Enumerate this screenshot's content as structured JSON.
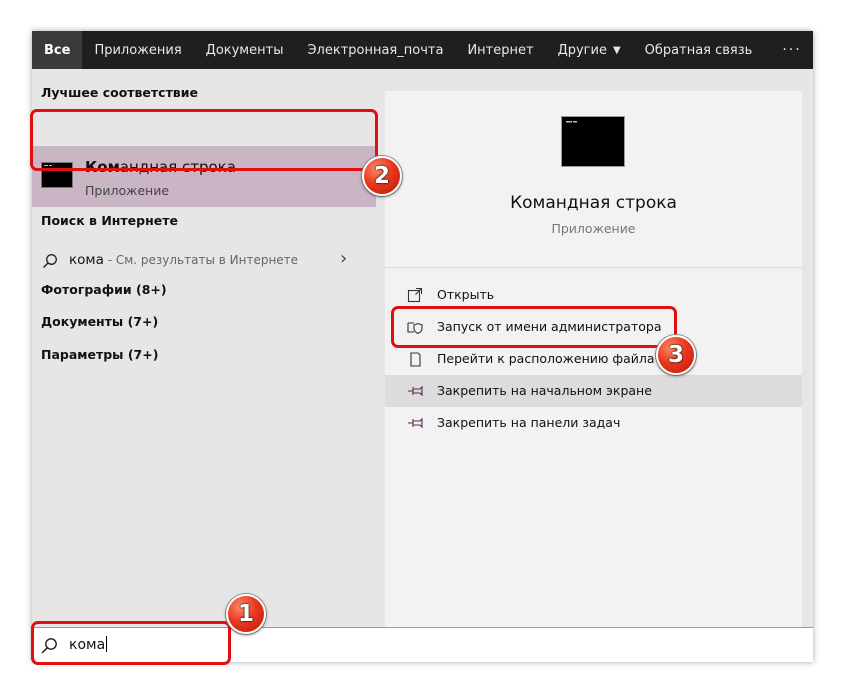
{
  "topnav": {
    "tabs": [
      {
        "label": "Все",
        "active": true
      },
      {
        "label": "Приложения"
      },
      {
        "label": "Документы"
      },
      {
        "label": "Электронная_почта"
      },
      {
        "label": "Интернет"
      },
      {
        "label": "Другие"
      }
    ],
    "feedback": "Обратная связь",
    "more": "···"
  },
  "left": {
    "best_match_header": "Лучшее соответствие",
    "best_match": {
      "title_bold": "Ком",
      "title_rest": "андная строка",
      "subtitle": "Приложение",
      "icon": "command-prompt-icon"
    },
    "web_header": "Поиск в Интернете",
    "web_item": {
      "query": "кома",
      "hint": " - См. результаты в Интернете",
      "icon": "search-icon"
    },
    "categories": [
      "Фотографии (8+)",
      "Документы (7+)",
      "Параметры (7+)"
    ]
  },
  "right": {
    "title": "Командная строка",
    "subtitle": "Приложение",
    "actions": [
      {
        "label": "Открыть",
        "icon": "open-icon"
      },
      {
        "label": "Запуск от имени администратора",
        "icon": "shield-icon"
      },
      {
        "label": "Перейти к расположению файла",
        "icon": "file-location-icon"
      },
      {
        "label": "Закрепить на начальном экране",
        "icon": "pin-icon",
        "highlighted": true
      },
      {
        "label": "Закрепить на панели задач",
        "icon": "pin-icon"
      }
    ]
  },
  "search": {
    "value": "кома",
    "icon": "search-icon"
  },
  "annotations": {
    "badge1": "1",
    "badge2": "2",
    "badge3": "3"
  },
  "colors": {
    "annotation_red": "#e10f0f",
    "selection": "#c9b5c4",
    "nav_bg": "#1f1f1f"
  }
}
